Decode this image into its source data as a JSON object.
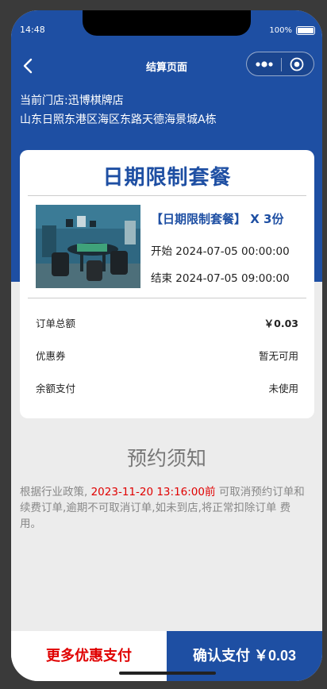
{
  "status": {
    "time": "14:48",
    "battery": "100%"
  },
  "nav": {
    "title": "结算页面"
  },
  "store": {
    "name_line": "当前门店:迅博棋牌店",
    "address": "山东日照东港区海区东路天德海景城A栋"
  },
  "package": {
    "title": "日期限制套餐",
    "name": "【日期限制套餐】 X 3份",
    "start": "开始 2024-07-05 00:00:00",
    "end": "结束 2024-07-05 09:00:00"
  },
  "order": {
    "total_label": "订单总额",
    "total_value": "￥0.03",
    "coupon_label": "优惠券",
    "coupon_value": "暂无可用",
    "balance_label": "余额支付",
    "balance_value": "未使用"
  },
  "notice": {
    "title": "预约须知",
    "prefix": "根据行业政策, ",
    "deadline": "2023-11-20 13:16:00前",
    "suffix": " 可取消预约订单和 续费订单,逾期不可取消订单,如未到店,将正常扣除订单 费用。"
  },
  "actions": {
    "more_label": "更多优惠支付",
    "pay_label": "确认支付 ￥0.03"
  },
  "colors": {
    "primary": "#1e4fa3",
    "highlight": "#e00000"
  }
}
